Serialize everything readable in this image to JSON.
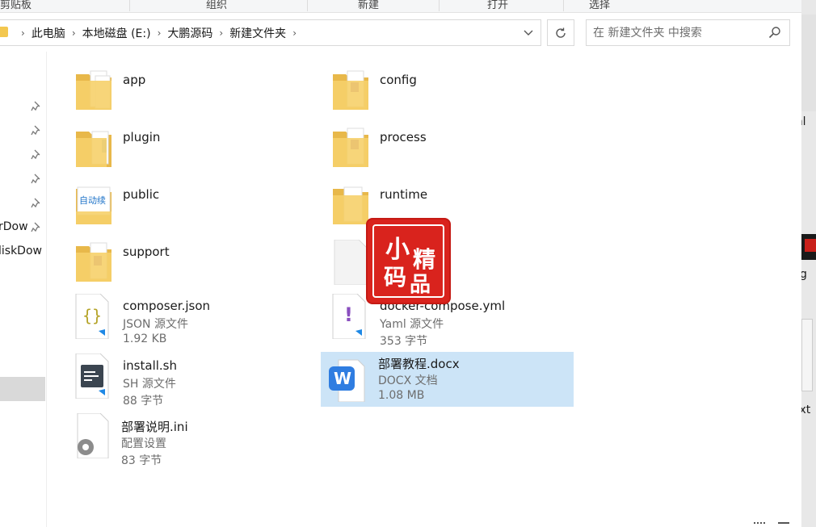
{
  "ribbon": {
    "groups": [
      "剪贴板",
      "组织",
      "新建",
      "打开",
      "选择"
    ]
  },
  "address": {
    "crumbs": [
      "此电脑",
      "本地磁盘 (E:)",
      "大鹏源码",
      "新建文件夹"
    ]
  },
  "search": {
    "placeholder": "在 新建文件夹 中搜索"
  },
  "nav": {
    "labels": [
      "rDow",
      "liskDow"
    ]
  },
  "files": [
    {
      "name": "app",
      "kind": "folder"
    },
    {
      "name": "config",
      "kind": "folder"
    },
    {
      "name": "plugin",
      "kind": "folder"
    },
    {
      "name": "process",
      "kind": "folder"
    },
    {
      "name": "public",
      "kind": "folder"
    },
    {
      "name": "runtime",
      "kind": "folder"
    },
    {
      "name": "support",
      "kind": "folder"
    },
    {
      "name": "",
      "kind": "file-blank"
    },
    {
      "name": "composer.json",
      "type": "JSON 源文件",
      "size": "1.92 KB",
      "kind": "json"
    },
    {
      "name": "docker-compose.yml",
      "type": "Yaml 源文件",
      "size": "353 字节",
      "kind": "yaml"
    },
    {
      "name": "install.sh",
      "type": "SH 源文件",
      "size": "88 字节",
      "kind": "sh"
    },
    {
      "name": "部署教程.docx",
      "type": "DOCX 文档",
      "size": "1.08 MB",
      "kind": "docx",
      "selected": true
    },
    {
      "name": "部署说明.ini",
      "type": "配置设置",
      "size": "83 字节",
      "kind": "ini"
    }
  ],
  "watermark": {
    "chars": [
      "小",
      "精",
      "码",
      "品"
    ]
  },
  "right_window": {
    "fragments": [
      "ml",
      "g",
      "txt"
    ]
  },
  "colors": {
    "selection": "#cce4f7",
    "folder": "#f3c74f",
    "stamp": "#d9231d"
  }
}
